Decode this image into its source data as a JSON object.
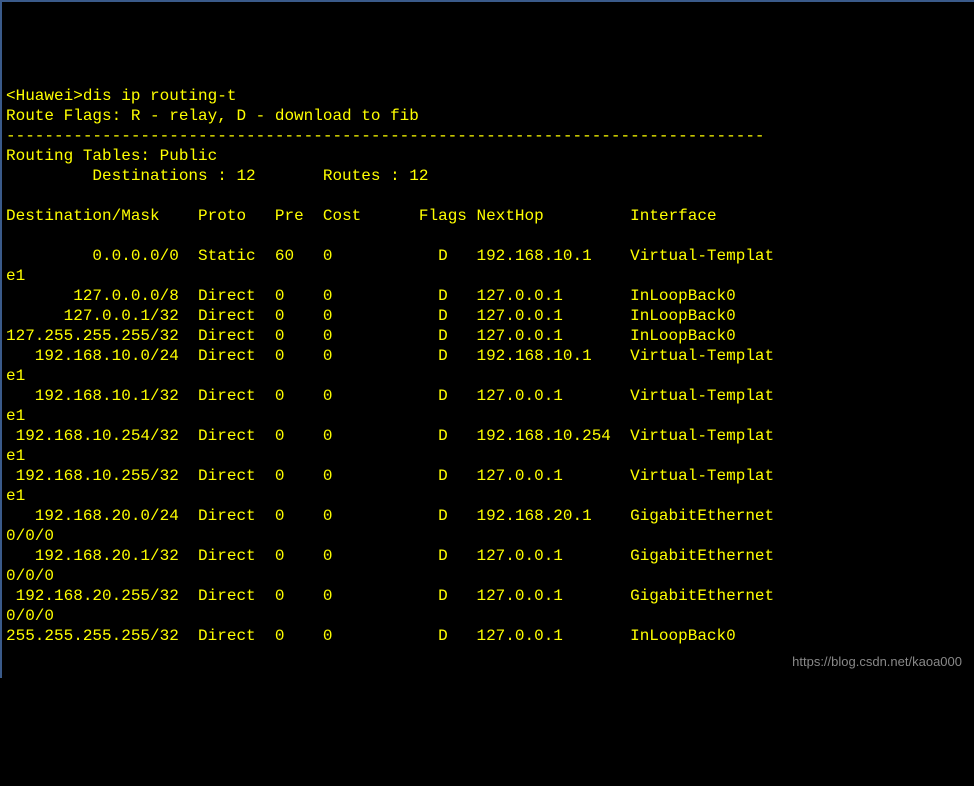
{
  "prompt": "<Huawei>",
  "command": "dis ip routing-t",
  "route_flags_label": "Route Flags: R - relay, D - download to fib",
  "separator": "-------------------------------------------------------------------------------",
  "routing_tables_label": "Routing Tables: Public",
  "destinations_label": "         Destinations : 12       Routes : 12",
  "headers": {
    "destination": "Destination/Mask",
    "proto": "Proto",
    "pre": "Pre",
    "cost": "Cost",
    "flags": "Flags",
    "nexthop": "NextHop",
    "interface": "Interface"
  },
  "routes": [
    {
      "dest": "        0.0.0.0/0",
      "proto": "Static",
      "pre": "60",
      "cost": "0",
      "flags": "D",
      "nexthop": "192.168.10.1",
      "iface": "Virtual-Templat",
      "wrap": "e1"
    },
    {
      "dest": "      127.0.0.0/8",
      "proto": "Direct",
      "pre": "0",
      "cost": "0",
      "flags": "D",
      "nexthop": "127.0.0.1",
      "iface": "InLoopBack0",
      "wrap": ""
    },
    {
      "dest": "     127.0.0.1/32",
      "proto": "Direct",
      "pre": "0",
      "cost": "0",
      "flags": "D",
      "nexthop": "127.0.0.1",
      "iface": "InLoopBack0",
      "wrap": ""
    },
    {
      "dest": "127.255.255.255/32",
      "proto": "Direct",
      "pre": "0",
      "cost": "0",
      "flags": "D",
      "nexthop": "127.0.0.1",
      "iface": "InLoopBack0",
      "wrap": ""
    },
    {
      "dest": "  192.168.10.0/24",
      "proto": "Direct",
      "pre": "0",
      "cost": "0",
      "flags": "D",
      "nexthop": "192.168.10.1",
      "iface": "Virtual-Templat",
      "wrap": "e1"
    },
    {
      "dest": "  192.168.10.1/32",
      "proto": "Direct",
      "pre": "0",
      "cost": "0",
      "flags": "D",
      "nexthop": "127.0.0.1",
      "iface": "Virtual-Templat",
      "wrap": "e1"
    },
    {
      "dest": "192.168.10.254/32",
      "proto": "Direct",
      "pre": "0",
      "cost": "0",
      "flags": "D",
      "nexthop": "192.168.10.254",
      "iface": "Virtual-Templat",
      "wrap": "e1"
    },
    {
      "dest": " 192.168.10.255/32",
      "proto": "Direct",
      "pre": "0",
      "cost": "0",
      "flags": "D",
      "nexthop": "127.0.0.1",
      "iface": "Virtual-Templat",
      "wrap": "e1"
    },
    {
      "dest": "  192.168.20.0/24",
      "proto": "Direct",
      "pre": "0",
      "cost": "0",
      "flags": "D",
      "nexthop": "192.168.20.1",
      "iface": "GigabitEthernet",
      "wrap": "0/0/0"
    },
    {
      "dest": "  192.168.20.1/32",
      "proto": "Direct",
      "pre": "0",
      "cost": "0",
      "flags": "D",
      "nexthop": "127.0.0.1",
      "iface": "GigabitEthernet",
      "wrap": "0/0/0"
    },
    {
      "dest": " 192.168.20.255/32",
      "proto": "Direct",
      "pre": "0",
      "cost": "0",
      "flags": "D",
      "nexthop": "127.0.0.1",
      "iface": "GigabitEthernet",
      "wrap": "0/0/0"
    },
    {
      "dest": "255.255.255.255/32",
      "proto": "Direct",
      "pre": "0",
      "cost": "0",
      "flags": "D",
      "nexthop": "127.0.0.1",
      "iface": "InLoopBack0",
      "wrap": ""
    }
  ],
  "watermark": "https://blog.csdn.net/kaoa000"
}
